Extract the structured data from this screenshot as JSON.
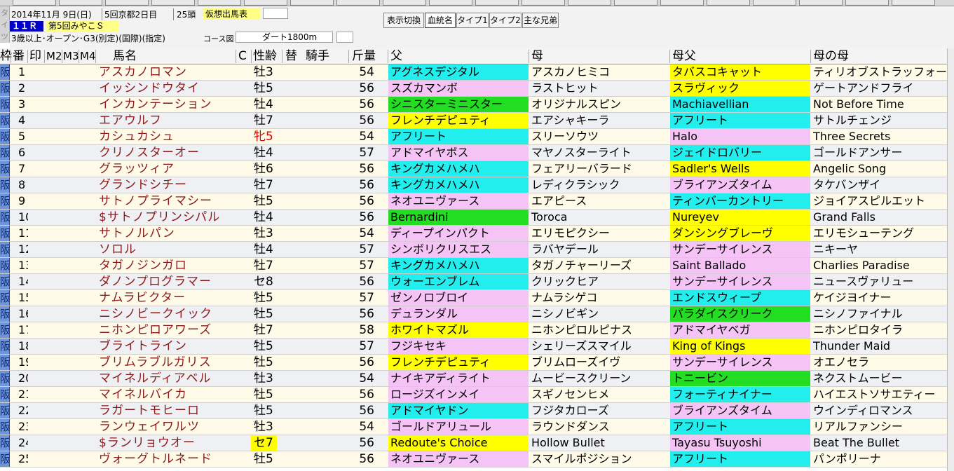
{
  "header": {
    "date": "2014年11月 9日(日)",
    "meeting": "5回京都2日目",
    "runners": "25頭",
    "virtual_label": "仮想出馬表",
    "race_no": "１１Ｒ",
    "race_name": "第5回みやこＳ",
    "conditions": "3歳以上･オープン･G3(別定)(国際)(指定)",
    "course_label": "コース図",
    "course": "ダート1800m",
    "side_chars": [
      "タ",
      "イ",
      "ツ"
    ]
  },
  "toolbar": {
    "switch": "表示切換",
    "tabs": [
      "血統名",
      "タイプ1",
      "タイプ2",
      "主な兄弟"
    ],
    "active": 0
  },
  "columns": {
    "waku": "枠",
    "ban": "番",
    "mark": "印",
    "m2": "M2",
    "m3": "M3",
    "m4": "M4",
    "name": "馬名",
    "c": "C",
    "sexage": "性齢",
    "kae": "替",
    "jockey": "騎手",
    "kinryo": "斤量",
    "sire": "父",
    "dam": "母",
    "bms": "母父",
    "gdam": "母の母"
  },
  "colors": {
    "cyan": "#22eeee",
    "pink": "#f6c3f6",
    "green": "#22dd22",
    "yellow": "#ffff00",
    "waku": "#6f94d8",
    "name": "#8c1a1a",
    "mare": "#e00000",
    "rowA": "#fffbe8",
    "rowB": "#eef0f4"
  },
  "rows": [
    {
      "waku": "阪",
      "num": "1",
      "name": "アスカノロマン",
      "sex": "牡3",
      "kin": "54",
      "p": [
        "アグネスデジタル",
        "アスカノヒミコ",
        "タバスコキャット",
        "ティリオブストラッフォード"
      ],
      "pc": [
        "cyan",
        "",
        "yellow",
        ""
      ]
    },
    {
      "waku": "阪",
      "num": "2",
      "name": "イッシンドウタイ",
      "sex": "牡5",
      "kin": "56",
      "p": [
        "スズカマンボ",
        "ラストヒット",
        "スラヴィック",
        "ゲートアンドフライ"
      ],
      "pc": [
        "pink",
        "",
        "yellow",
        ""
      ]
    },
    {
      "waku": "阪",
      "num": "3",
      "name": "インカンテーション",
      "sex": "牡4",
      "kin": "56",
      "p": [
        "シニスターミニスター",
        "オリジナルスピン",
        "Machiavellian",
        "Not Before Time"
      ],
      "pc": [
        "green",
        "",
        "cyan",
        ""
      ]
    },
    {
      "waku": "阪",
      "num": "4",
      "name": "エアウルフ",
      "sex": "牡7",
      "kin": "56",
      "p": [
        "フレンチデピュティ",
        "エアシャキーラ",
        "アフリート",
        "サトルチェンジ"
      ],
      "pc": [
        "yellow",
        "",
        "cyan",
        ""
      ]
    },
    {
      "waku": "阪",
      "num": "5",
      "name": "カシュカシュ",
      "sex": "牝5",
      "kin": "54",
      "p": [
        "アフリート",
        "スリーソウツ",
        "Halo",
        "Three Secrets"
      ],
      "pc": [
        "cyan",
        "",
        "pink",
        ""
      ],
      "mare": true
    },
    {
      "waku": "阪",
      "num": "6",
      "name": "クリノスターオー",
      "sex": "牡4",
      "kin": "57",
      "p": [
        "アドマイヤボス",
        "マヤノスターライト",
        "ジェイドロバリー",
        "ゴールドアンサー"
      ],
      "pc": [
        "pink",
        "",
        "cyan",
        ""
      ]
    },
    {
      "waku": "阪",
      "num": "7",
      "name": "グラッツィア",
      "sex": "牡6",
      "kin": "56",
      "p": [
        "キングカメハメハ",
        "フェアリーバラード",
        "Sadler's Wells",
        "Angelic Song"
      ],
      "pc": [
        "cyan",
        "",
        "yellow",
        ""
      ]
    },
    {
      "waku": "阪",
      "num": "8",
      "name": "グランドシチー",
      "sex": "牡7",
      "kin": "56",
      "p": [
        "キングカメハメハ",
        "レディクラシック",
        "ブライアンズタイム",
        "タケバンザイ"
      ],
      "pc": [
        "cyan",
        "",
        "pink",
        ""
      ]
    },
    {
      "waku": "阪",
      "num": "9",
      "name": "サトノプライマシー",
      "sex": "牡5",
      "kin": "56",
      "p": [
        "ネオユニヴァース",
        "エアピース",
        "ティンバーカントリー",
        "ジョイアスピルエット"
      ],
      "pc": [
        "pink",
        "",
        "cyan",
        ""
      ]
    },
    {
      "waku": "阪",
      "num": "10",
      "name": "$サトノプリンシパル",
      "sex": "牡4",
      "kin": "56",
      "p": [
        "Bernardini",
        "Toroca",
        "Nureyev",
        "Grand Falls"
      ],
      "pc": [
        "green",
        "",
        "yellow",
        ""
      ]
    },
    {
      "waku": "阪",
      "num": "11",
      "name": "サトノルパン",
      "sex": "牡3",
      "kin": "54",
      "p": [
        "ディープインパクト",
        "エリモピクシー",
        "ダンシングブレーヴ",
        "エリモシューテング"
      ],
      "pc": [
        "pink",
        "",
        "yellow",
        ""
      ]
    },
    {
      "waku": "阪",
      "num": "12",
      "name": "ソロル",
      "sex": "牡4",
      "kin": "57",
      "p": [
        "シンボリクリスエス",
        "ラバヤデール",
        "サンデーサイレンス",
        "ニキーヤ"
      ],
      "pc": [
        "pink",
        "",
        "pink",
        ""
      ]
    },
    {
      "waku": "阪",
      "num": "13",
      "name": "タガノジンガロ",
      "sex": "牡7",
      "kin": "57",
      "p": [
        "キングカメハメハ",
        "タガノチャーリーズ",
        "Saint Ballado",
        "Charlies Paradise"
      ],
      "pc": [
        "cyan",
        "",
        "pink",
        ""
      ]
    },
    {
      "waku": "阪",
      "num": "14",
      "name": "ダノンプログラマー",
      "sex": "セ8",
      "kin": "56",
      "p": [
        "ウォーエンブレム",
        "クリックヒア",
        "サンデーサイレンス",
        "ニュースヴァリュー"
      ],
      "pc": [
        "cyan",
        "",
        "pink",
        ""
      ]
    },
    {
      "waku": "阪",
      "num": "15",
      "name": "ナムラビクター",
      "sex": "牡5",
      "kin": "57",
      "p": [
        "ゼンノロブロイ",
        "ナムラシゲコ",
        "エンドスウィープ",
        "ケイジヨイナー"
      ],
      "pc": [
        "pink",
        "",
        "cyan",
        ""
      ]
    },
    {
      "waku": "阪",
      "num": "16",
      "name": "ニシノビークイック",
      "sex": "牡5",
      "kin": "56",
      "p": [
        "デュランダル",
        "ニシノビギン",
        "パラダイスクリーク",
        "ニシノファイナル"
      ],
      "pc": [
        "pink",
        "",
        "green",
        ""
      ]
    },
    {
      "waku": "阪",
      "num": "17",
      "name": "ニホンピロアワーズ",
      "sex": "牡7",
      "kin": "58",
      "p": [
        "ホワイトマズル",
        "ニホンピロルピナス",
        "アドマイヤベガ",
        "ニホンピロタイラ"
      ],
      "pc": [
        "yellow",
        "",
        "pink",
        ""
      ]
    },
    {
      "waku": "阪",
      "num": "18",
      "name": "ブライトライン",
      "sex": "牡5",
      "kin": "57",
      "p": [
        "フジキセキ",
        "シェリーズスマイル",
        "King of Kings",
        "Thunder Maid"
      ],
      "pc": [
        "pink",
        "",
        "yellow",
        ""
      ]
    },
    {
      "waku": "阪",
      "num": "19",
      "name": "ブリムラブルガリス",
      "sex": "牡5",
      "kin": "56",
      "p": [
        "フレンチデピュティ",
        "ブリムローズイヴ",
        "サンデーサイレンス",
        "オエノセラ"
      ],
      "pc": [
        "yellow",
        "",
        "pink",
        ""
      ]
    },
    {
      "waku": "阪",
      "num": "20",
      "name": "マイネルディアベル",
      "sex": "牡3",
      "kin": "54",
      "p": [
        "ナイキアディライト",
        "ムービースクリーン",
        "トニービン",
        "ネクストムービー"
      ],
      "pc": [
        "pink",
        "",
        "green",
        ""
      ]
    },
    {
      "waku": "阪",
      "num": "21",
      "name": "マイネルバイカ",
      "sex": "牡5",
      "kin": "56",
      "p": [
        "ロージズインメイ",
        "スギノセンヒメ",
        "フォーティナイナー",
        "ハイエストソサエティー"
      ],
      "pc": [
        "pink",
        "",
        "cyan",
        ""
      ]
    },
    {
      "waku": "阪",
      "num": "22",
      "name": "ラガートモヒーロ",
      "sex": "牡5",
      "kin": "56",
      "p": [
        "アドマイヤドン",
        "フジタカローズ",
        "ブライアンズタイム",
        "ウインディロマンス"
      ],
      "pc": [
        "cyan",
        "",
        "pink",
        ""
      ]
    },
    {
      "waku": "阪",
      "num": "23",
      "name": "ランウェイワルツ",
      "sex": "牡3",
      "kin": "54",
      "p": [
        "ゴールドアリュール",
        "ラウンドダンス",
        "アフリート",
        "リアルファンシー"
      ],
      "pc": [
        "pink",
        "",
        "cyan",
        ""
      ]
    },
    {
      "waku": "阪",
      "num": "24",
      "name": "$ランリョウオー",
      "sex": "セ7",
      "kin": "56",
      "p": [
        "Redoute's Choice",
        "Hollow Bullet",
        "Tayasu Tsuyoshi",
        "Beat The Bullet"
      ],
      "pc": [
        "yellow",
        "",
        "pink",
        ""
      ],
      "sexhl": true
    },
    {
      "waku": "阪",
      "num": "25",
      "name": "ヴォーグトルネード",
      "sex": "牡5",
      "kin": "56",
      "p": [
        "ネオユニヴァース",
        "スマイルポジション",
        "アフリート",
        "パンポリーナ"
      ],
      "pc": [
        "pink",
        "",
        "cyan",
        ""
      ]
    }
  ]
}
